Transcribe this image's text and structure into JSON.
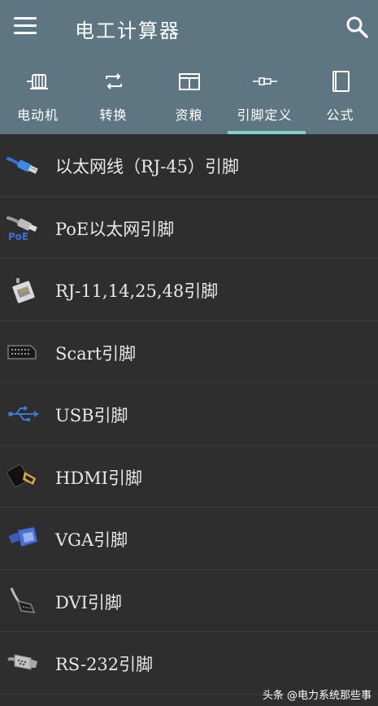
{
  "header": {
    "title": "电工计算器"
  },
  "tabs": [
    {
      "label": "电动机",
      "icon": "motor-icon"
    },
    {
      "label": "转换",
      "icon": "convert-icon"
    },
    {
      "label": "资粮",
      "icon": "resources-icon"
    },
    {
      "label": "引脚定义",
      "icon": "pinout-icon",
      "selected": true
    },
    {
      "label": "公式",
      "icon": "formula-book-icon"
    }
  ],
  "colors": {
    "appbar": "#5e7682",
    "background": "#2e2e2e",
    "tab_indicator": "#7fd3c9",
    "text": "#e8e8e8"
  },
  "list": [
    {
      "label": "以太网线（RJ-45）引脚",
      "icon": "ethernet-cable-icon"
    },
    {
      "label": "PoE以太网引脚",
      "icon": "poe-icon"
    },
    {
      "label": "RJ-11,14,25,48引脚",
      "icon": "rj11-connector-icon"
    },
    {
      "label": "Scart引脚",
      "icon": "scart-connector-icon"
    },
    {
      "label": "USB引脚",
      "icon": "usb-icon"
    },
    {
      "label": "HDMI引脚",
      "icon": "hdmi-connector-icon"
    },
    {
      "label": "VGA引脚",
      "icon": "vga-connector-icon"
    },
    {
      "label": "DVI引脚",
      "icon": "dvi-connector-icon"
    },
    {
      "label": "RS-232引脚",
      "icon": "rs232-connector-icon"
    }
  ],
  "watermark": "头条 @电力系统那些事"
}
